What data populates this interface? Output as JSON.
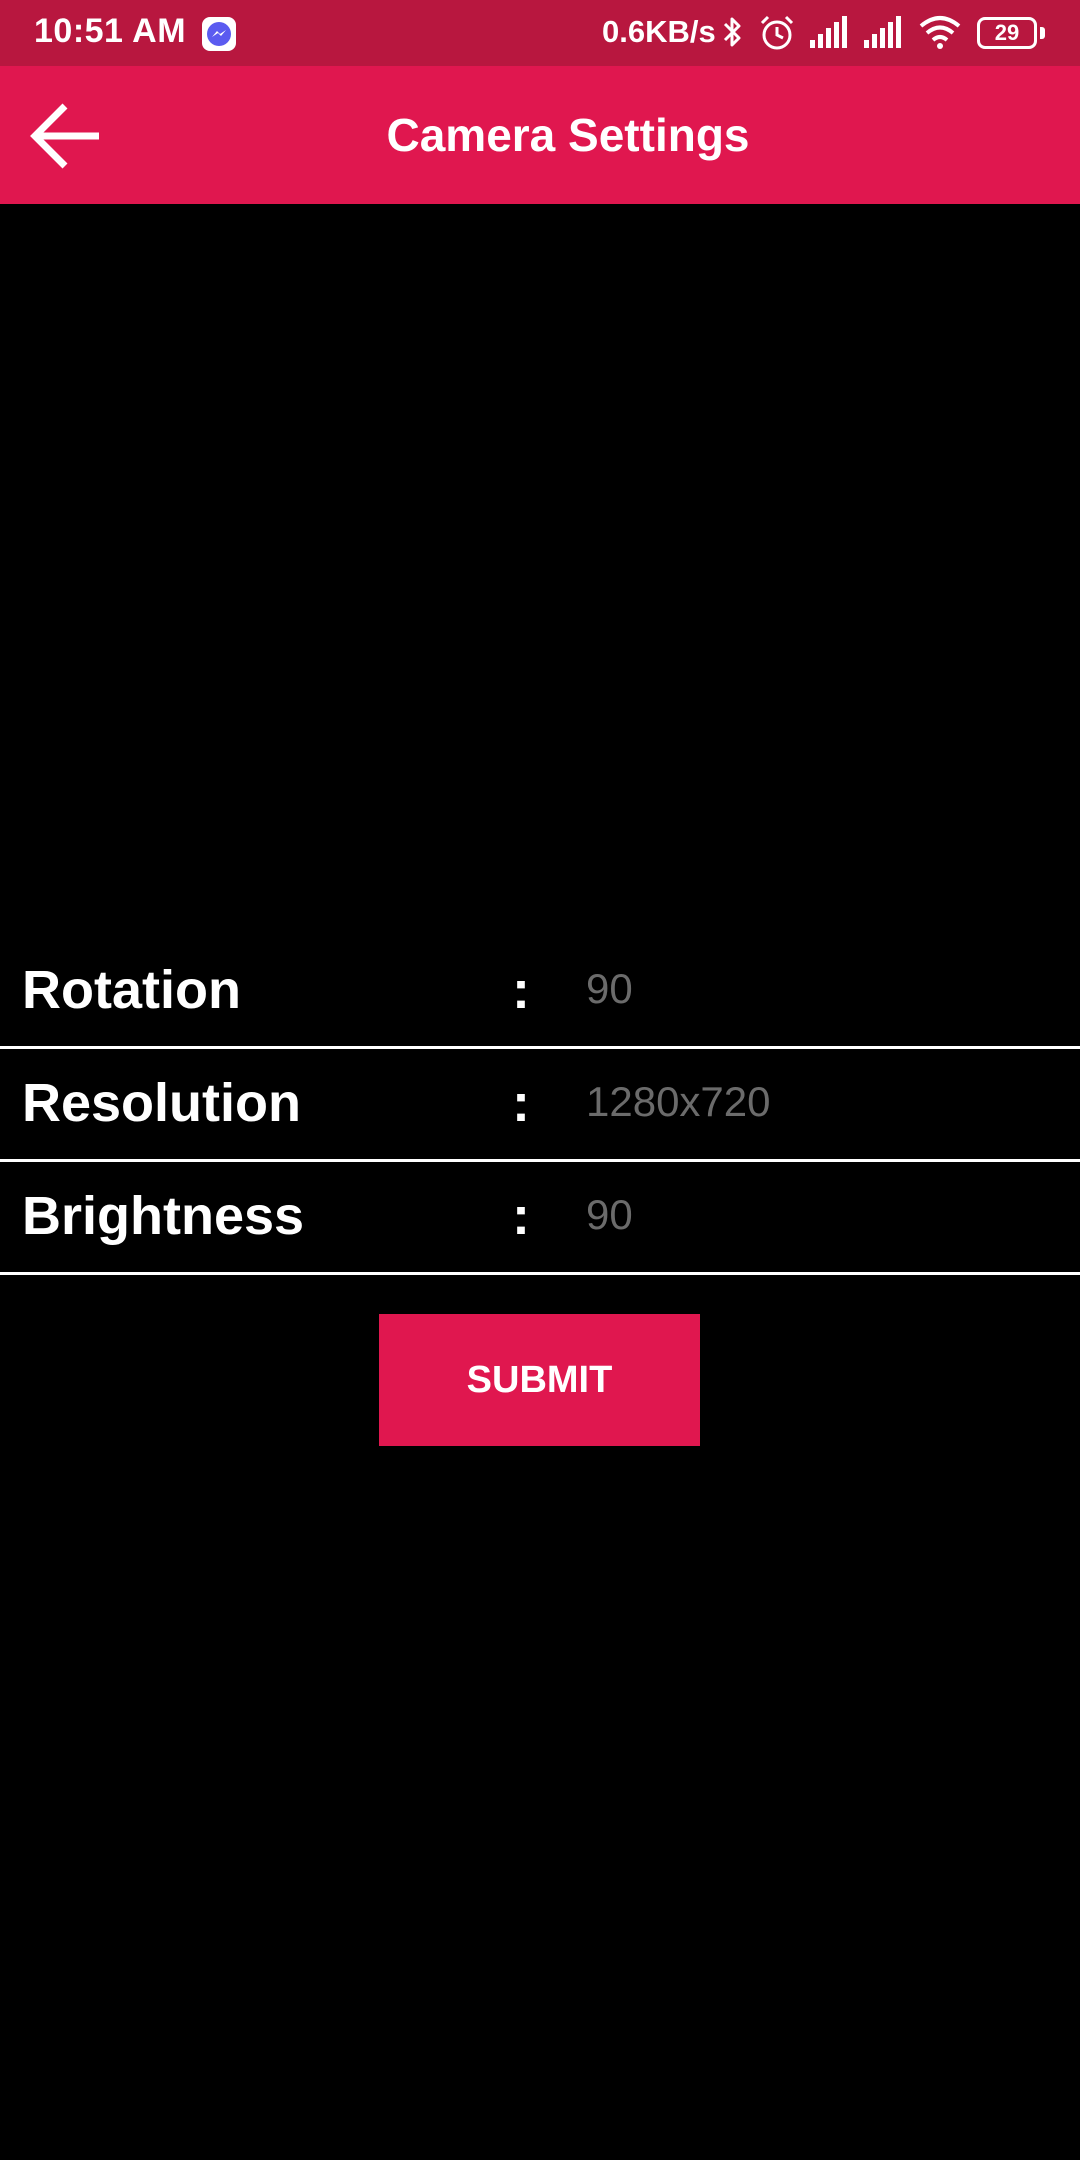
{
  "status_bar": {
    "time": "10:51 AM",
    "net_speed": "0.6KB/s",
    "battery": "29",
    "icons": [
      "messenger-icon",
      "bluetooth-icon",
      "alarm-icon",
      "signal-icon",
      "signal-icon",
      "wifi-icon",
      "battery-icon"
    ]
  },
  "app_bar": {
    "title": "Camera Settings",
    "back_icon": "arrow-left-icon"
  },
  "settings": [
    {
      "label": "Rotation",
      "separator": ":",
      "value": "90"
    },
    {
      "label": "Resolution",
      "separator": ":",
      "value": "1280x720"
    },
    {
      "label": "Brightness",
      "separator": ":",
      "value": "90"
    }
  ],
  "submit_label": "SUBMIT",
  "colors": {
    "status_bar": "#b8173f",
    "accent": "#e0174f",
    "background": "#000000",
    "value_text": "#6b6b6b"
  }
}
